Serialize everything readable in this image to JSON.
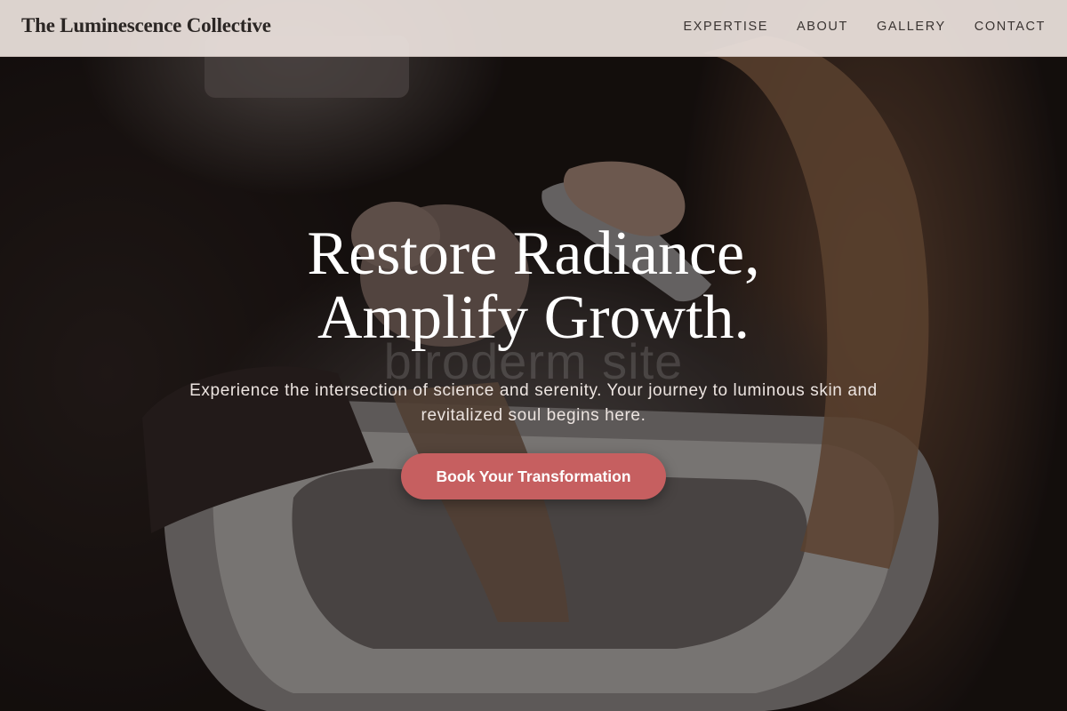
{
  "header": {
    "brand": "The Luminescence Collective",
    "nav": [
      {
        "label": "EXPERTISE"
      },
      {
        "label": "ABOUT"
      },
      {
        "label": "GALLERY"
      },
      {
        "label": "CONTACT"
      }
    ]
  },
  "hero": {
    "title_line_1": "Restore Radiance,",
    "title_line_2": "Amplify Growth.",
    "subtitle": "Experience the intersection of science and serenity. Your journey to luminous skin and revitalized soul begins here.",
    "cta_label": "Book Your Transformation",
    "watermark": "biroderm site",
    "background_image": "salon-hair-wash-photo"
  },
  "colors": {
    "header_bg": "#ece2de",
    "cta_bg": "#c65f60",
    "text_light": "#ffffff",
    "text_dark": "#2b2624"
  }
}
